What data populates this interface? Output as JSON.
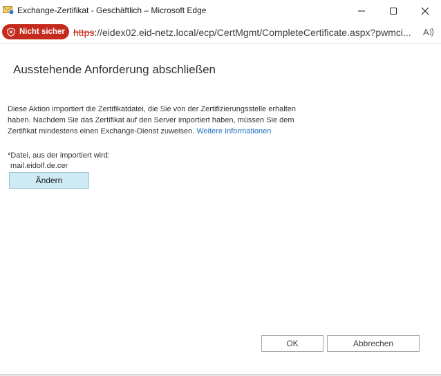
{
  "window": {
    "title": "Exchange-Zertifikat - Geschäftlich – Microsoft Edge",
    "app_icon": "envelope-certificate-icon",
    "controls": [
      "minimize-icon",
      "maximize-icon",
      "close-icon"
    ]
  },
  "addressbar": {
    "security_label": "Nicht sicher",
    "security_icon": "shield-warning-icon",
    "url_scheme": "https",
    "url_rest": "://eidex02.eid-netz.local/ecp/CertMgmt/CompleteCertificate.aspx?pwmci...",
    "read_aloud_icon": "read-aloud-icon"
  },
  "dialog": {
    "heading": "Ausstehende Anforderung abschließen",
    "description": "Diese Aktion importiert die Zertifikatdatei, die Sie von der Zertifizierungsstelle erhalten haben. Nachdem Sie das Zertifikat auf den Server importiert haben, müssen Sie dem Zertifikat mindestens einen Exchange-Dienst zuweisen.",
    "more_info_link": "Weitere Informationen",
    "file_label": "*Datei, aus der importiert wird:",
    "file_value": "mail.eidolf.de.cer",
    "change_button": "Ändern",
    "ok_button": "OK",
    "cancel_button": "Abbrechen"
  },
  "colors": {
    "security_pill": "#c42b1c",
    "link": "#1e6fbf",
    "change_button_bg": "#cdeaf5"
  }
}
